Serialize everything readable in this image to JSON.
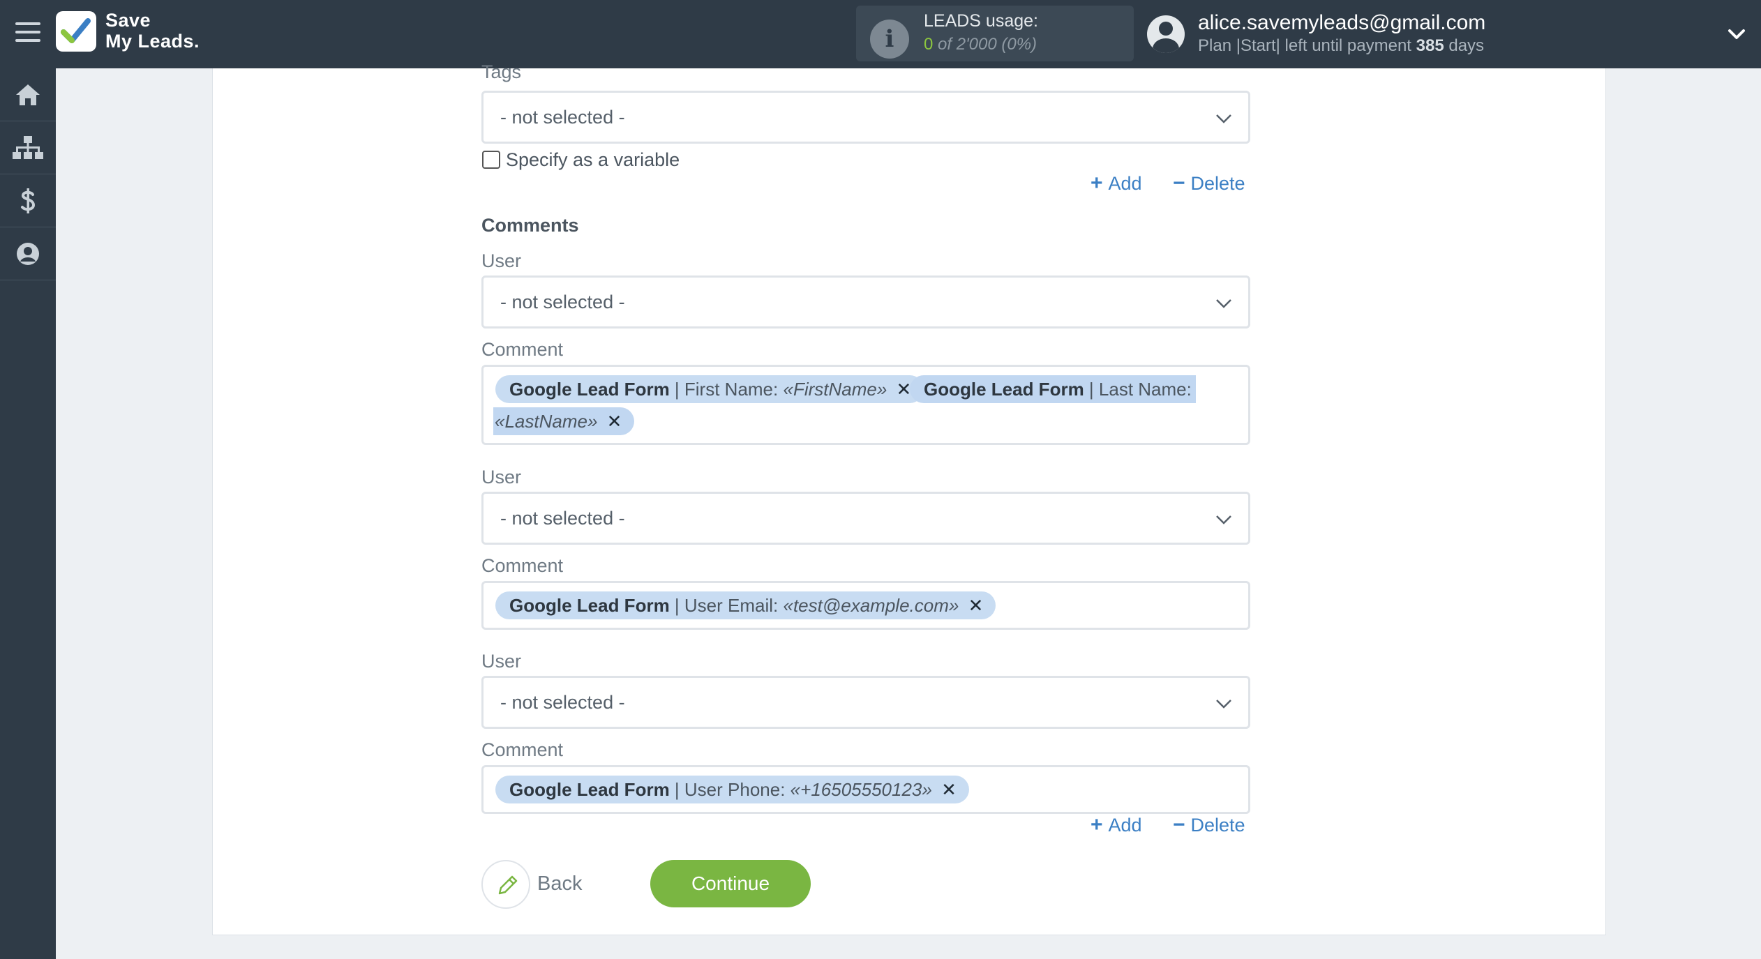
{
  "brand": {
    "line1": "Save",
    "line2": "My Leads."
  },
  "usage": {
    "title": "LEADS usage:",
    "count": "0",
    "of": "of 2'000",
    "pct": "(0%)"
  },
  "account": {
    "email": "alice.savemyleads@gmail.com",
    "plan_prefix": "Plan |Start| left until payment",
    "days": "385",
    "days_suffix": "days"
  },
  "sidebar": {
    "items": [
      {
        "icon": "home-icon"
      },
      {
        "icon": "sitemap-icon"
      },
      {
        "icon": "dollar-icon"
      },
      {
        "icon": "user-icon"
      }
    ]
  },
  "form": {
    "tags": {
      "label": "Tags",
      "value": "- not selected -",
      "checkbox_label": "Specify as a variable",
      "checked": false
    },
    "actions_top": {
      "add": "Add",
      "delete": "Delete"
    },
    "comments_title": "Comments",
    "groups": [
      {
        "user_label": "User",
        "user_value": "- not selected -",
        "comment_label": "Comment",
        "chips": [
          {
            "source": "Google Lead Form",
            "field": "| First Name:",
            "value": "«FirstName»"
          },
          {
            "source": "Google Lead Form",
            "field": "| Last Name:",
            "value": "«LastName»"
          }
        ]
      },
      {
        "user_label": "User",
        "user_value": "- not selected -",
        "comment_label": "Comment",
        "chips": [
          {
            "source": "Google Lead Form",
            "field": "| User Email:",
            "value": "«test@example.com»"
          }
        ]
      },
      {
        "user_label": "User",
        "user_value": "- not selected -",
        "comment_label": "Comment",
        "chips": [
          {
            "source": "Google Lead Form",
            "field": "| User Phone:",
            "value": "«+16505550123»"
          }
        ]
      }
    ],
    "actions_bottom": {
      "add": "Add",
      "delete": "Delete"
    },
    "back_label": "Back",
    "continue_label": "Continue"
  },
  "colors": {
    "topbar": "#2f3b47",
    "accent_green": "#7ab642",
    "link_blue": "#3b7fc4",
    "chip_blue": "#c8dcf2"
  }
}
